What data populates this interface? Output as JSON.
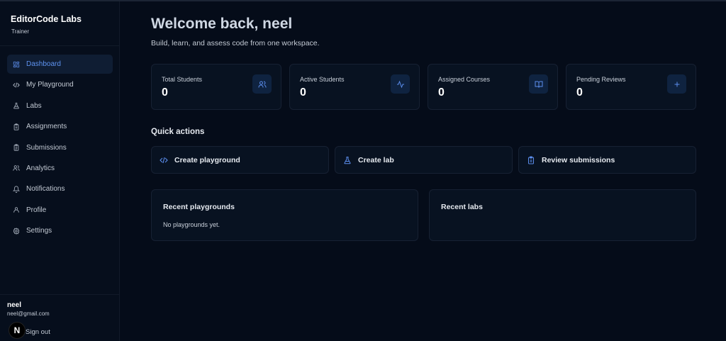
{
  "sidebar": {
    "brand": "EditorCode Labs",
    "role": "Trainer",
    "items": [
      {
        "label": "Dashboard",
        "icon": "dashboard-icon",
        "active": true
      },
      {
        "label": "My Playground",
        "icon": "code-icon"
      },
      {
        "label": "Labs",
        "icon": "flask-icon"
      },
      {
        "label": "Assignments",
        "icon": "clipboard-icon"
      },
      {
        "label": "Submissions",
        "icon": "clipboard-list-icon"
      },
      {
        "label": "Analytics",
        "icon": "users-icon"
      },
      {
        "label": "Notifications",
        "icon": "bell-icon"
      },
      {
        "label": "Profile",
        "icon": "user-icon"
      },
      {
        "label": "Settings",
        "icon": "gear-icon"
      }
    ],
    "user": {
      "name": "neel",
      "email": "neel@gmail.com",
      "avatar_letter": "N"
    },
    "signout_label": "Sign out"
  },
  "main": {
    "title": "Welcome back, neel",
    "subtitle": "Build, learn, and assess code from one workspace.",
    "stats": [
      {
        "label": "Total Students",
        "value": "0",
        "icon": "users-icon"
      },
      {
        "label": "Active Students",
        "value": "0",
        "icon": "activity-icon"
      },
      {
        "label": "Assigned Courses",
        "value": "0",
        "icon": "book-open-icon"
      },
      {
        "label": "Pending Reviews",
        "value": "0",
        "icon": "plus-icon"
      }
    ],
    "quick_actions_title": "Quick actions",
    "quick_actions": [
      {
        "label": "Create playground",
        "icon": "code-icon"
      },
      {
        "label": "Create lab",
        "icon": "flask-icon"
      },
      {
        "label": "Review submissions",
        "icon": "clipboard-icon"
      }
    ],
    "recent_playgrounds": {
      "title": "Recent playgrounds",
      "empty": "No playgrounds yet."
    },
    "recent_labs": {
      "title": "Recent labs"
    }
  },
  "colors": {
    "accent": "#5b8dec",
    "background": "#050c19",
    "card": "#081221",
    "border": "#172133"
  }
}
